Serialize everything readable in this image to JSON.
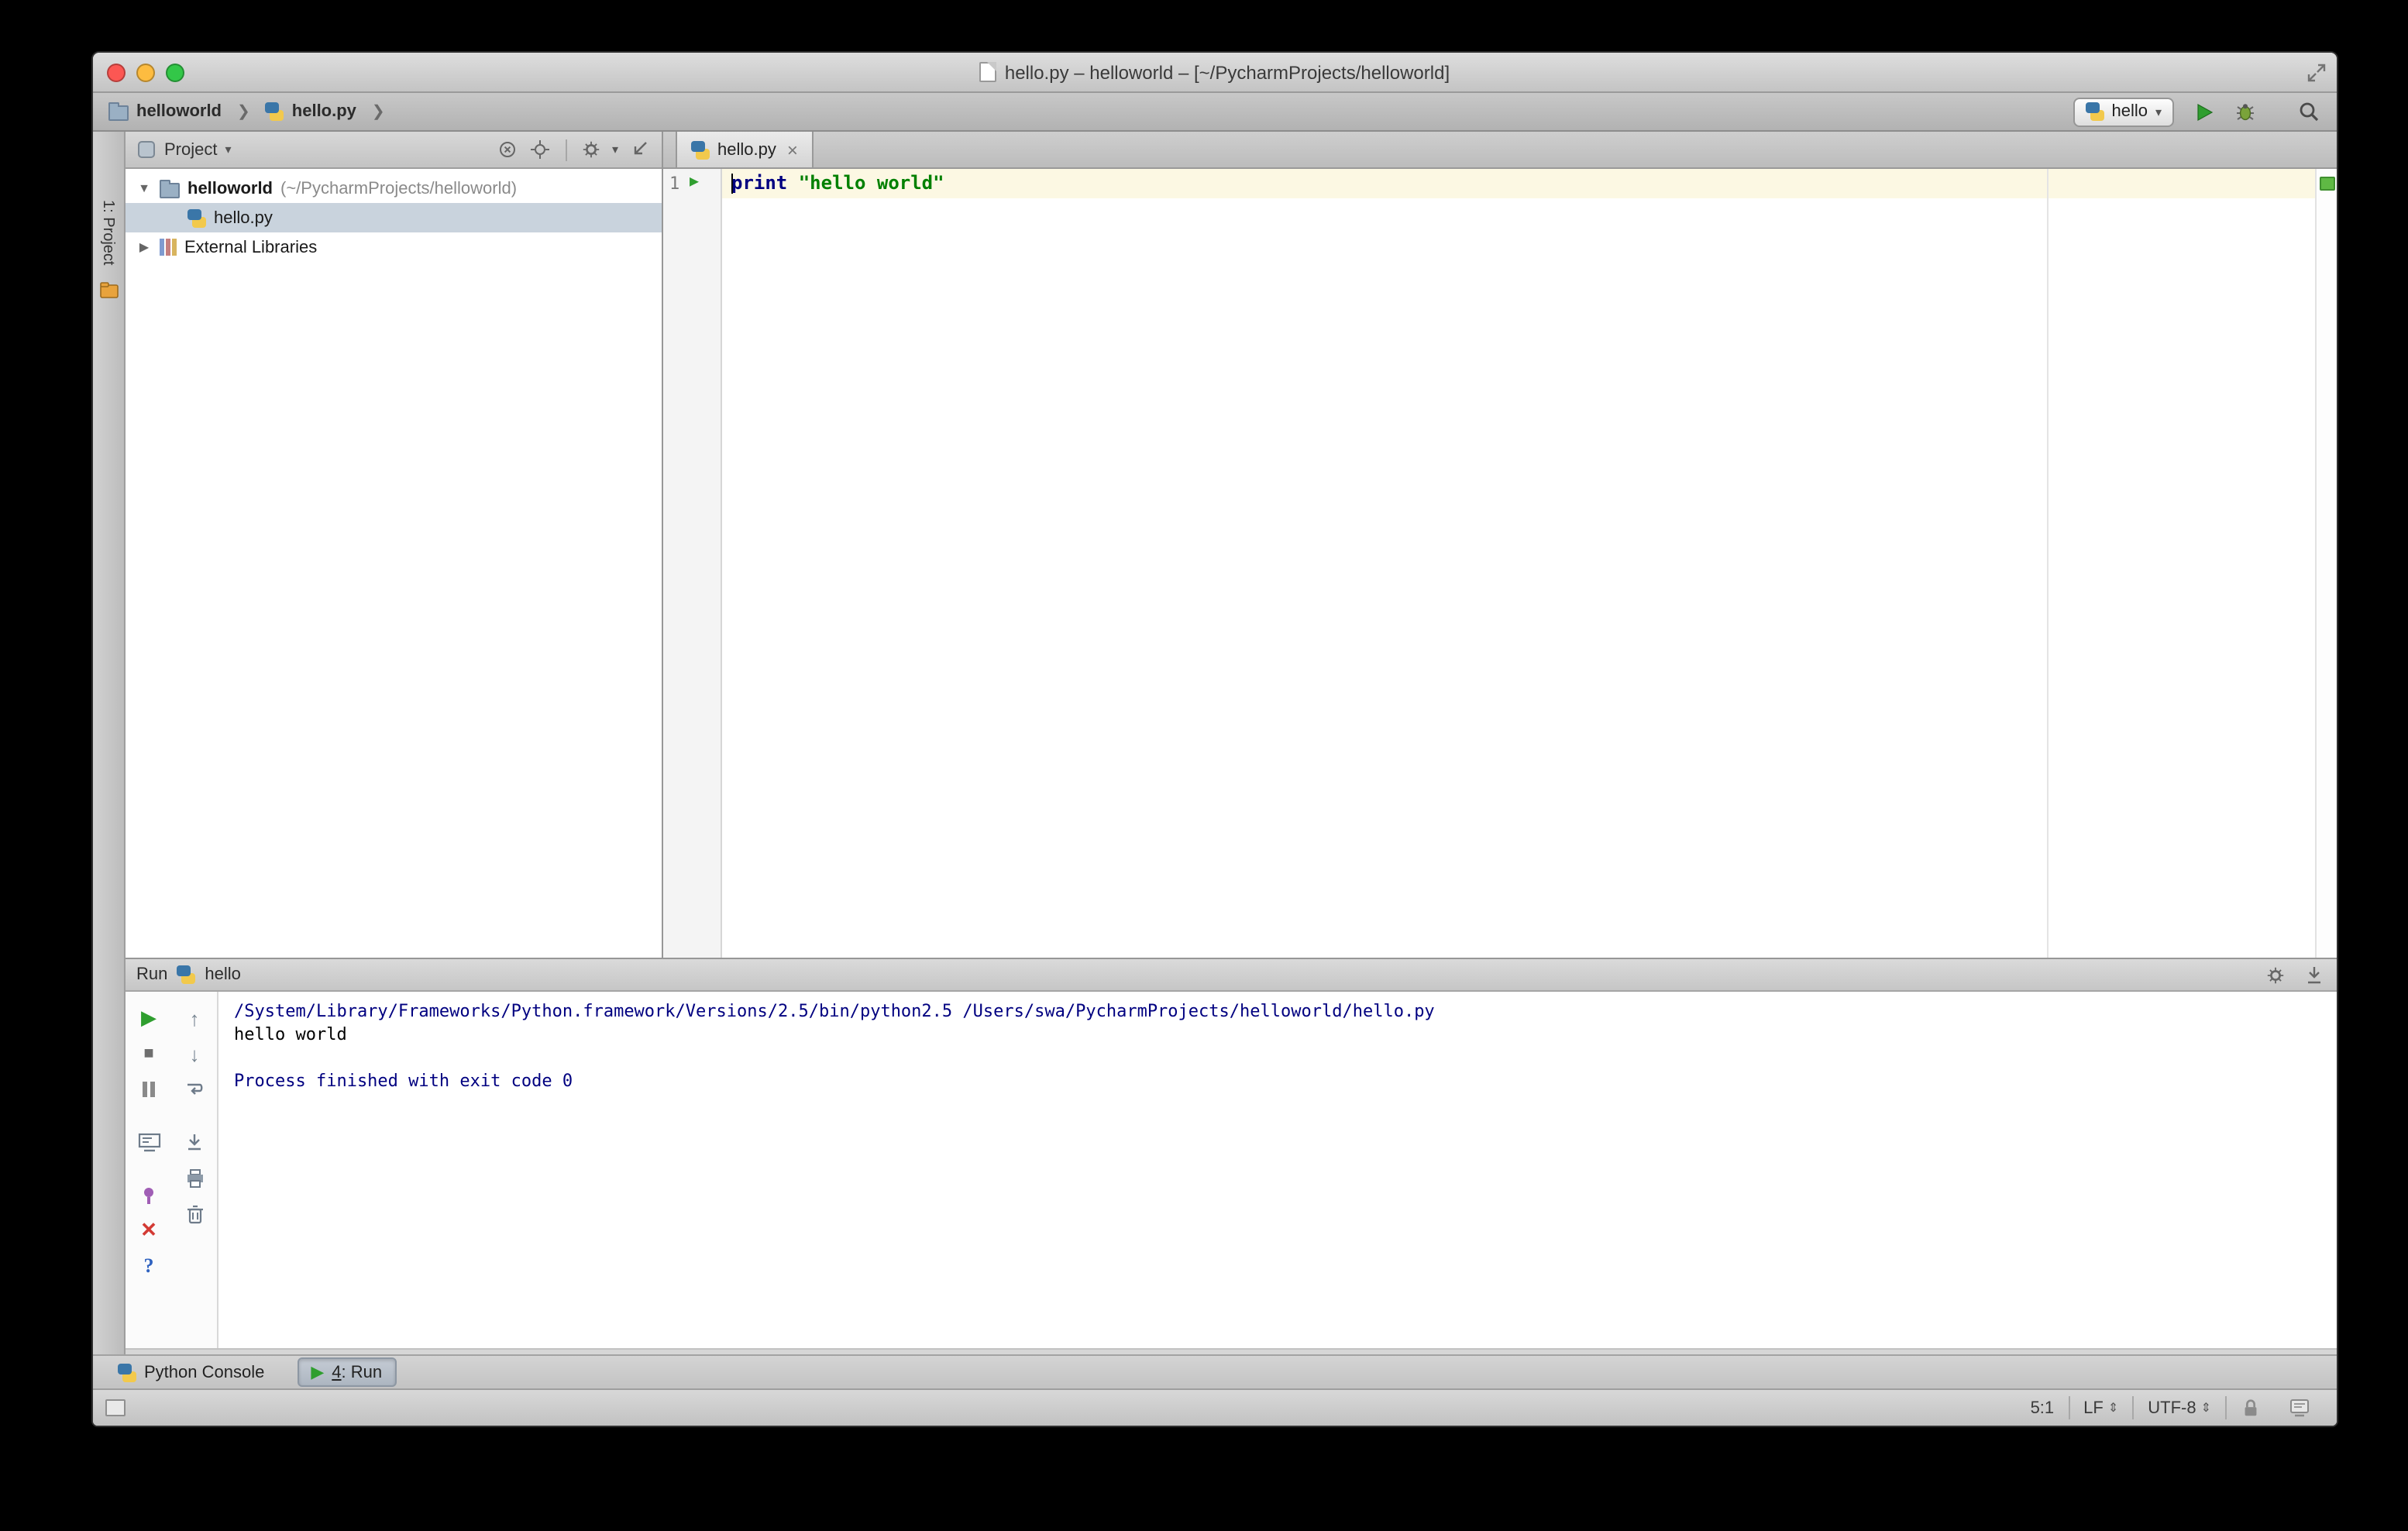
{
  "window": {
    "title": "hello.py – helloworld – [~/PycharmProjects/helloworld]"
  },
  "navbar": {
    "breadcrumbs": [
      {
        "label": "helloworld"
      },
      {
        "label": "hello.py"
      }
    ],
    "run_config": "hello"
  },
  "tool_stripe": {
    "project_button": "1: Project"
  },
  "project_panel": {
    "header": "Project",
    "root_label": "helloworld",
    "root_path": "(~/PycharmProjects/helloworld)",
    "file_label": "hello.py",
    "libs_label": "External Libraries"
  },
  "editor": {
    "tab_label": "hello.py",
    "line_number": "1",
    "keyword": "print",
    "string": "\"hello world\""
  },
  "run_panel": {
    "title": "Run",
    "config_label": "hello",
    "console": [
      {
        "text": "/System/Library/Frameworks/Python.framework/Versions/2.5/bin/python2.5 /Users/swa/PycharmProjects/helloworld/hello.py",
        "type": "system"
      },
      {
        "text": "hello world",
        "type": "stdout"
      },
      {
        "text": "",
        "type": "stdout"
      },
      {
        "text": "Process finished with exit code 0",
        "type": "system"
      }
    ]
  },
  "tool_buttons": {
    "python_console": "Python Console",
    "run_mnemonic": "4",
    "run_rest": ": Run"
  },
  "status_bar": {
    "caret": "5:1",
    "line_separator": "LF",
    "encoding": "UTF-8"
  },
  "colors": {
    "keyword": "#000080",
    "string": "#008000",
    "console_system": "#000080",
    "run_green": "#2f9e2f",
    "selection": "#c9d3dd",
    "current_line": "#fcf8e3",
    "stripe_ok": "#5fb944"
  }
}
